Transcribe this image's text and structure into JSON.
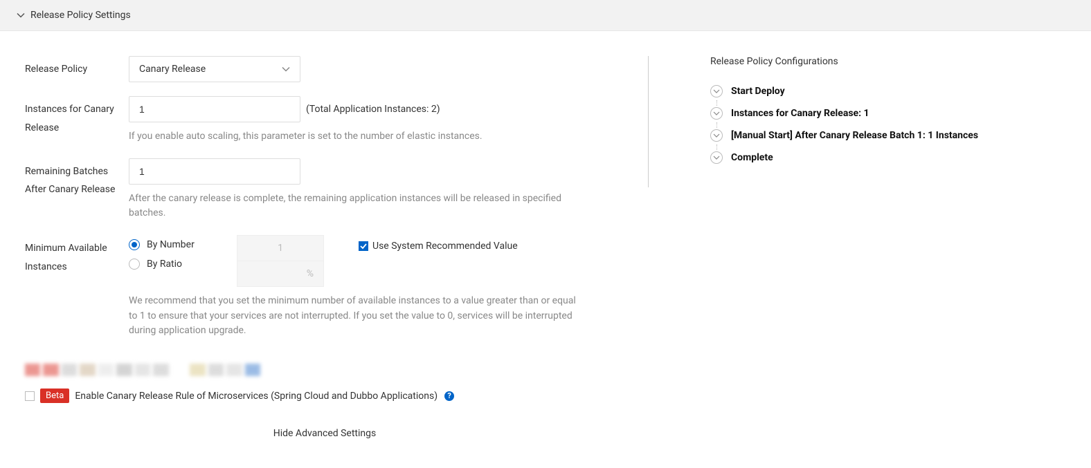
{
  "header": {
    "title": "Release Policy Settings"
  },
  "releasePolicy": {
    "label": "Release Policy",
    "selected": "Canary Release"
  },
  "instancesForCanary": {
    "label": "Instances for Canary Release",
    "value": "1",
    "note": "(Total Application Instances: 2)",
    "help": "If you enable auto scaling, this parameter is set to the number of elastic instances."
  },
  "remainingBatches": {
    "label": "Remaining Batches After Canary Release",
    "value": "1",
    "help": "After the canary release is complete, the remaining application instances will be released in specified batches."
  },
  "minAvailable": {
    "label": "Minimum Available Instances",
    "byNumber": "By Number",
    "byRatio": "By Ratio",
    "numberValue": "1",
    "ratioUnit": "%",
    "useRecommendedLabel": "Use System Recommended Value",
    "help": "We recommend that you set the minimum number of available instances to a value greater than or equal to 1 to ensure that your services are not interrupted. If you set the value to 0, services will be interrupted during application upgrade."
  },
  "betaRow": {
    "badge": "Beta",
    "label": "Enable Canary Release Rule of Microservices (Spring Cloud and Dubbo Applications)"
  },
  "hideAdvanced": "Hide Advanced Settings",
  "configPanel": {
    "title": "Release Policy Configurations",
    "steps": [
      "Start Deploy",
      "Instances for Canary Release: 1",
      "[Manual Start] After Canary Release Batch 1: 1 Instances",
      "Complete"
    ]
  }
}
